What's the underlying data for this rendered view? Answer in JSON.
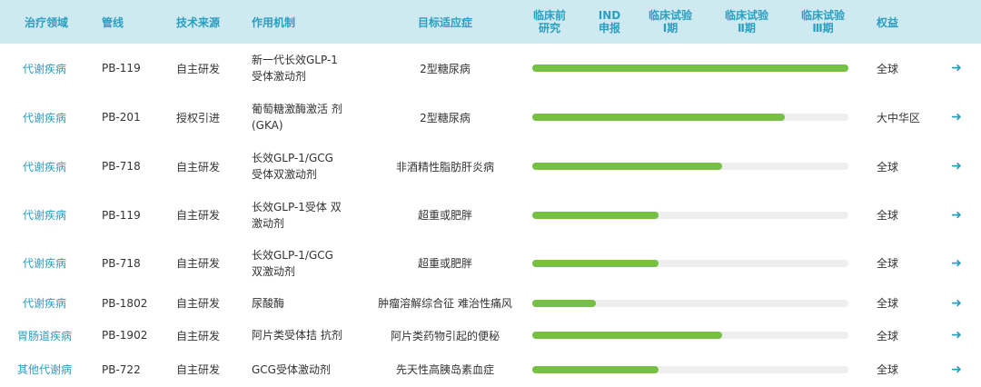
{
  "headers": {
    "area": "治疗领域",
    "pipeline": "管线",
    "source": "技术来源",
    "mechanism": "作用机制",
    "indication": "目标适应症",
    "phase1": "临床前\n研究",
    "phase2": "IND\n申报",
    "phase3": "临床试验\nⅠ期",
    "phase4": "临床试验\nⅡ期",
    "phase5": "临床试验\nⅢ期",
    "rights": "权益"
  },
  "rows": [
    {
      "area": "代谢疾病",
      "pipeline": "PB-119",
      "source": "自主研发",
      "mechanism": "新一代长效GLP-1受体激动剂",
      "indication": "2型糖尿病",
      "progress": 1.0,
      "rights": "全球"
    },
    {
      "area": "代谢疾病",
      "pipeline": "PB-201",
      "source": "授权引进",
      "mechanism": "葡萄糖激酶激活 剂(GKA)",
      "indication": "2型糖尿病",
      "progress": 0.8,
      "rights": "大中华区"
    },
    {
      "area": "代谢疾病",
      "pipeline": "PB-718",
      "source": "自主研发",
      "mechanism": "长效GLP-1/GCG受体双激动剂",
      "indication": "非酒精性脂肪肝炎病",
      "progress": 0.6,
      "rights": "全球"
    },
    {
      "area": "代谢疾病",
      "pipeline": "PB-119",
      "source": "自主研发",
      "mechanism": "长效GLP-1受体 双激动剂",
      "indication": "超重或肥胖",
      "progress": 0.4,
      "rights": "全球"
    },
    {
      "area": "代谢疾病",
      "pipeline": "PB-718",
      "source": "自主研发",
      "mechanism": "长效GLP-1/GCG双激动剂",
      "indication": "超重或肥胖",
      "progress": 0.4,
      "rights": "全球"
    },
    {
      "area": "代谢疾病",
      "pipeline": "PB-1802",
      "source": "自主研发",
      "mechanism": "尿酸酶",
      "indication": "肿瘤溶解综合征 难治性痛风",
      "progress": 0.2,
      "rights": "全球"
    },
    {
      "area": "胃肠道疾病",
      "pipeline": "PB-1902",
      "source": "自主研发",
      "mechanism": "阿片类受体拮 抗剂",
      "indication": "阿片类药物引起的便秘",
      "progress": 0.6,
      "rights": "全球"
    },
    {
      "area": "其他代谢病",
      "pipeline": "PB-722",
      "source": "自主研发",
      "mechanism": "GCG受体激动剂",
      "indication": "先天性高胰岛素血症",
      "progress": 0.4,
      "rights": "全球"
    }
  ],
  "arrow_glyph": "➜",
  "colors": {
    "accent": "#2a9fc0",
    "header_bg": "#cfe9f0",
    "bar_fill": "#76c043",
    "bar_track": "#eeeeee"
  }
}
